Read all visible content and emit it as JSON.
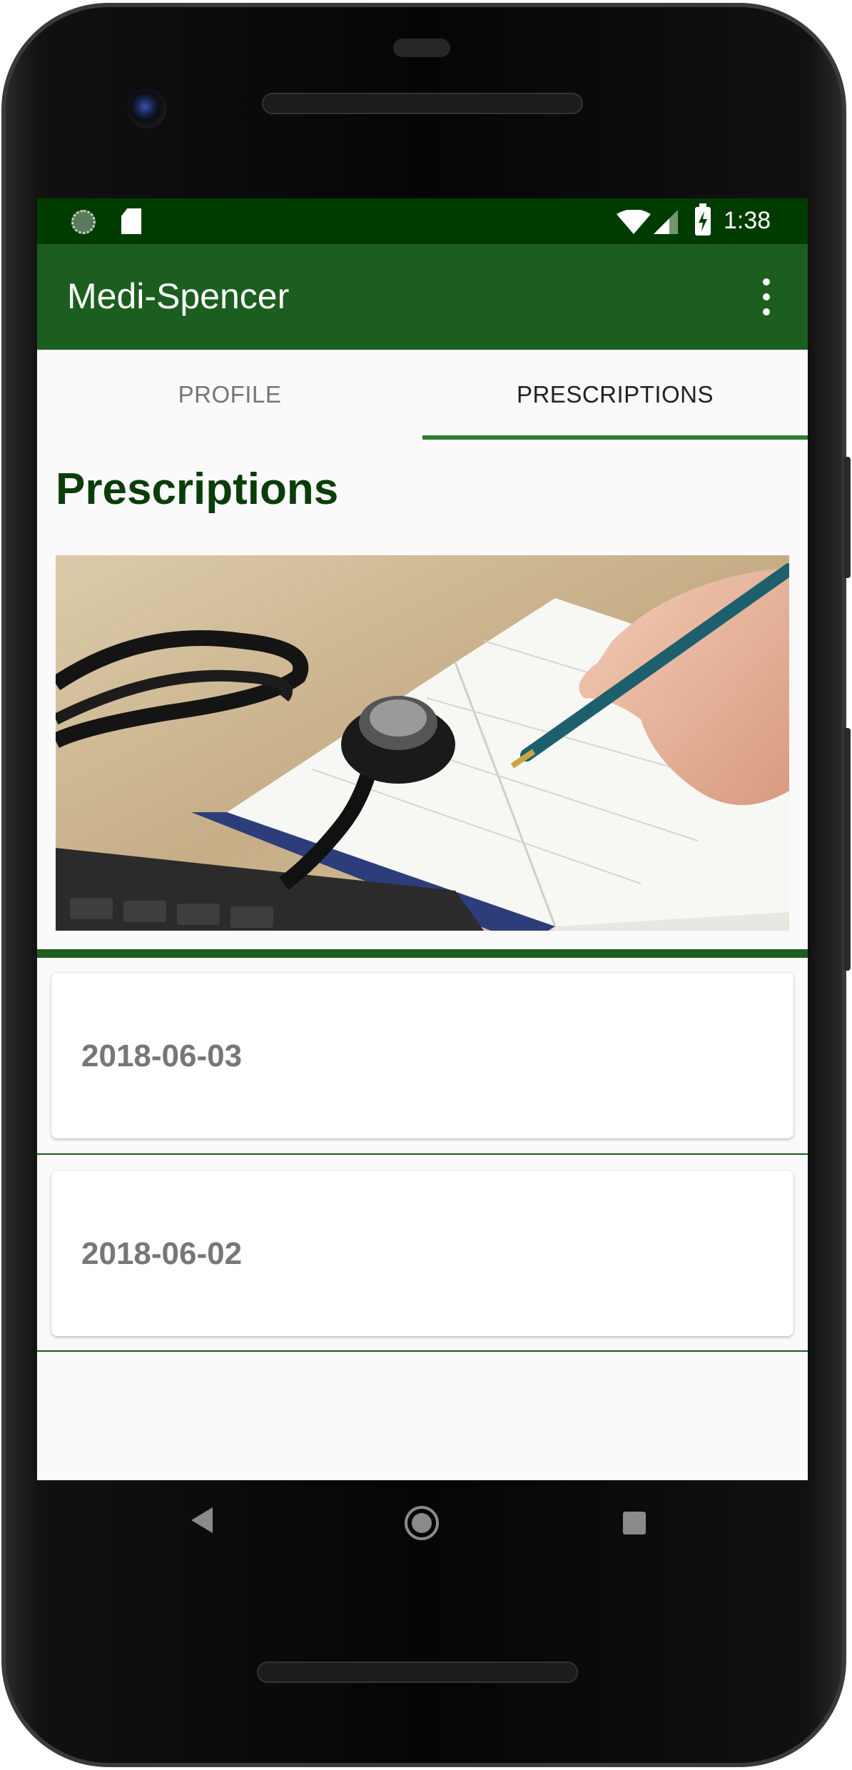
{
  "status_bar": {
    "time": "1:38"
  },
  "app_bar": {
    "title": "Medi-Spencer"
  },
  "tabs": [
    {
      "label": "PROFILE",
      "selected": false
    },
    {
      "label": "PRESCRIPTIONS",
      "selected": true
    }
  ],
  "section_title": "Prescriptions",
  "prescriptions": [
    {
      "date": "2018-06-03"
    },
    {
      "date": "2018-06-02"
    }
  ],
  "colors": {
    "status_bar": "#003c00",
    "app_bar": "#1b5e20",
    "accent": "#2e7d32",
    "title_text": "#0a3d0a"
  },
  "icons": {
    "status_left": [
      "sync-icon",
      "sd-card-icon"
    ],
    "status_right": [
      "wifi-icon",
      "cell-signal-icon",
      "battery-charging-icon"
    ],
    "app_bar": "overflow-menu-icon",
    "nav": [
      "back-icon",
      "home-icon",
      "recents-icon"
    ]
  }
}
